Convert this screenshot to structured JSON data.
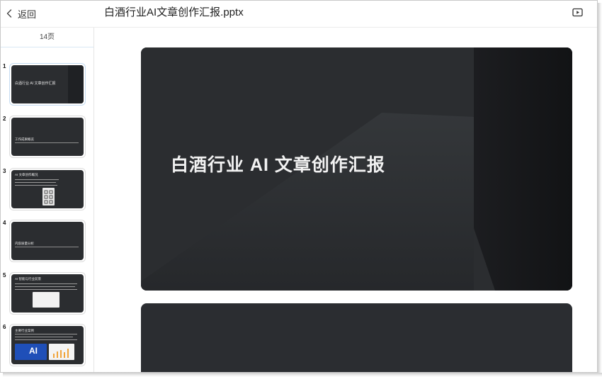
{
  "header": {
    "back_label": "返回",
    "title": "白酒行业AI文章创作汇报.pptx",
    "play_icon": "play-icon"
  },
  "sidebar": {
    "page_count": "14页",
    "thumbnails": [
      {
        "number": "1",
        "text": "白酒行业 AI 文章创作汇报"
      },
      {
        "number": "2",
        "text": "工作成果概览"
      },
      {
        "number": "3",
        "text": "AI 文章创作概况"
      },
      {
        "number": "4",
        "text": "内容质量分析"
      },
      {
        "number": "5",
        "text": "AI 智能与行业前景"
      },
      {
        "number": "6",
        "text": "主要行业案例",
        "badge": "AI"
      }
    ]
  },
  "main": {
    "slide1_title": "白酒行业 AI 文章创作汇报"
  }
}
